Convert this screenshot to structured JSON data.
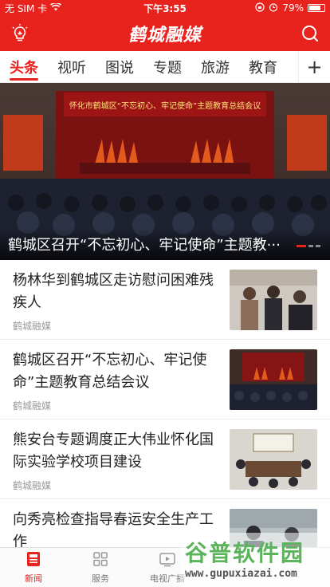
{
  "status_bar": {
    "carrier": "无 SIM 卡",
    "time": "下午3:55",
    "battery": "79%",
    "battery_level": 0.79
  },
  "header": {
    "logo": "鹤城融媒"
  },
  "tabs": [
    {
      "label": "头条",
      "active": true
    },
    {
      "label": "视听",
      "active": false
    },
    {
      "label": "图说",
      "active": false
    },
    {
      "label": "专题",
      "active": false
    },
    {
      "label": "旅游",
      "active": false
    },
    {
      "label": "教育",
      "active": false
    }
  ],
  "tabs_add": "+",
  "hero": {
    "banner_text": "怀化市鹤城区“不忘初心、牢记使命”主题教育总结会议",
    "caption": "鹤城区召开“不忘初心、牢记使命”主题教···"
  },
  "news": [
    {
      "title": "杨林华到鹤城区走访慰问困难残疾人",
      "source": "鹤城融媒"
    },
    {
      "title": "鹤城区召开“不忘初心、牢记使命”主题教育总结会议",
      "source": "鹤城融媒"
    },
    {
      "title": "熊安台专题调度正大伟业怀化国际实验学校项目建设",
      "source": "鹤城融媒"
    },
    {
      "title": "向秀亮检查指导春运安全生产工作",
      "source": ""
    }
  ],
  "bottom_nav": [
    {
      "label": "新闻",
      "icon": "news-icon",
      "active": true
    },
    {
      "label": "服务",
      "icon": "grid-icon",
      "active": false
    },
    {
      "label": "电视广播",
      "icon": "tv-icon",
      "active": false
    }
  ],
  "watermark": {
    "text": "谷普软件园",
    "url": "www.gupuxiazai.com"
  },
  "colors": {
    "brand": "#e8231e"
  }
}
